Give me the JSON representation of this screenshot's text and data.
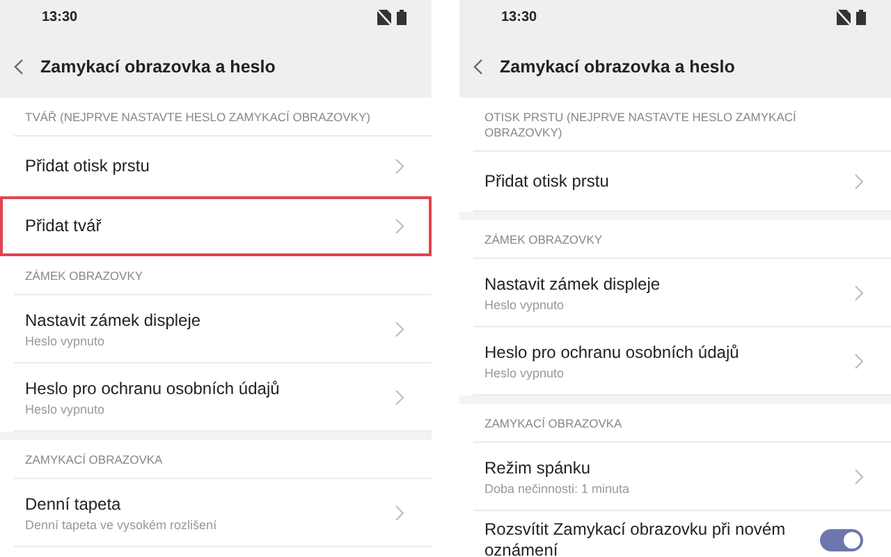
{
  "screens": [
    {
      "status_time": "13:30",
      "title": "Zamykací obrazovka a heslo",
      "sections": [
        {
          "header": "TVÁŘ (NEJPRVE NASTAVTE HESLO ZAMYKACÍ OBRAZOVKY)",
          "band_before": false,
          "items": [
            {
              "kind": "link",
              "title": "Přidat otisk prstu",
              "highlighted": false
            },
            {
              "kind": "link",
              "title": "Přidat tvář",
              "highlighted": true
            }
          ]
        },
        {
          "header": "ZÁMEK OBRAZOVKY",
          "band_before": false,
          "items": [
            {
              "kind": "link",
              "title": "Nastavit zámek displeje",
              "subtitle": "Heslo vypnuto",
              "highlighted": false
            },
            {
              "kind": "link",
              "title": "Heslo pro ochranu osobních údajů",
              "subtitle": "Heslo vypnuto",
              "highlighted": false
            }
          ]
        },
        {
          "header": "ZAMYKACÍ OBRAZOVKA",
          "band_before": true,
          "items": [
            {
              "kind": "link",
              "title": "Denní tapeta",
              "subtitle": "Denní tapeta ve vysokém rozlišení",
              "highlighted": false
            }
          ]
        }
      ]
    },
    {
      "status_time": "13:30",
      "title": "Zamykací obrazovka a heslo",
      "sections": [
        {
          "header": "OTISK PRSTU (NEJPRVE NASTAVTE HESLO ZAMYKACÍ OBRAZOVKY)",
          "band_before": false,
          "items": [
            {
              "kind": "link",
              "title": "Přidat otisk prstu",
              "highlighted": false
            }
          ]
        },
        {
          "header": "ZÁMEK OBRAZOVKY",
          "band_before": true,
          "items": [
            {
              "kind": "link",
              "title": "Nastavit zámek displeje",
              "subtitle": "Heslo vypnuto",
              "highlighted": false
            },
            {
              "kind": "link",
              "title": "Heslo pro ochranu osobních údajů",
              "subtitle": "Heslo vypnuto",
              "highlighted": false
            }
          ]
        },
        {
          "header": "ZAMYKACÍ OBRAZOVKA",
          "band_before": true,
          "items": [
            {
              "kind": "link",
              "title": "Režim spánku",
              "subtitle": "Doba nečinnosti: 1 minuta",
              "highlighted": false
            },
            {
              "kind": "toggle",
              "title": "Rozsvítit Zamykací obrazovku při novém oznámení",
              "on": true,
              "highlighted": false
            }
          ]
        }
      ]
    }
  ]
}
